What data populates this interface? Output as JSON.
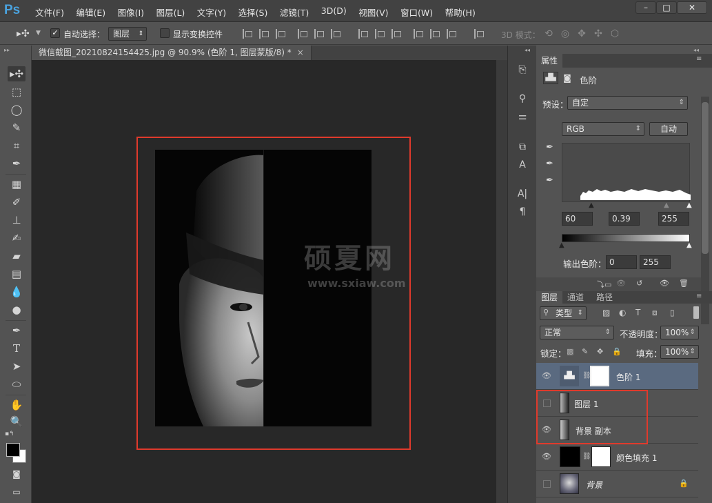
{
  "app": {
    "logo": "Ps"
  },
  "menu": [
    "文件(F)",
    "编辑(E)",
    "图像(I)",
    "图层(L)",
    "文字(Y)",
    "选择(S)",
    "滤镜(T)",
    "3D(D)",
    "视图(V)",
    "窗口(W)",
    "帮助(H)"
  ],
  "window_controls": {
    "minimize": "–",
    "maximize": "□",
    "close": "✕"
  },
  "options": {
    "auto_select_label": "自动选择：",
    "auto_select_checked": true,
    "auto_select_target": "图层",
    "show_transform_label": "显示变换控件",
    "mode_3d_label": "3D 模式："
  },
  "document": {
    "tab_title": "微信截图_20210824154425.jpg @ 90.9% (色阶 1, 图层蒙版/8) *",
    "watermark_cn": "硕夏网",
    "watermark_url": "www.sxiaw.com"
  },
  "properties": {
    "panel_title": "属性",
    "adjustment_name": "色阶",
    "preset_label": "预设：",
    "preset_value": "自定",
    "channel": "RGB",
    "auto_button": "自动",
    "input_black": "60",
    "input_gamma": "0.39",
    "input_white": "255",
    "output_label": "输出色阶：",
    "output_black": "0",
    "output_white": "255"
  },
  "layers_panel": {
    "tabs": [
      "图层",
      "通道",
      "路径"
    ],
    "filter_kind": "类型",
    "blend_mode": "正常",
    "opacity_label": "不透明度：",
    "opacity_value": "100%",
    "lock_label": "锁定：",
    "fill_label": "填充：",
    "fill_value": "100%",
    "layers": [
      {
        "name": "色阶 1",
        "visible": true,
        "selected": true
      },
      {
        "name": "图层 1",
        "visible": false,
        "selected": false
      },
      {
        "name": "背景 副本",
        "visible": true,
        "selected": false
      },
      {
        "name": "颜色填充 1",
        "visible": true,
        "selected": false
      },
      {
        "name": "背景",
        "visible": false,
        "selected": false
      }
    ]
  },
  "colors": {
    "highlight_red": "#e03a2c",
    "selected_layer": "#5a6a80",
    "ps_blue": "#4aa3df"
  }
}
